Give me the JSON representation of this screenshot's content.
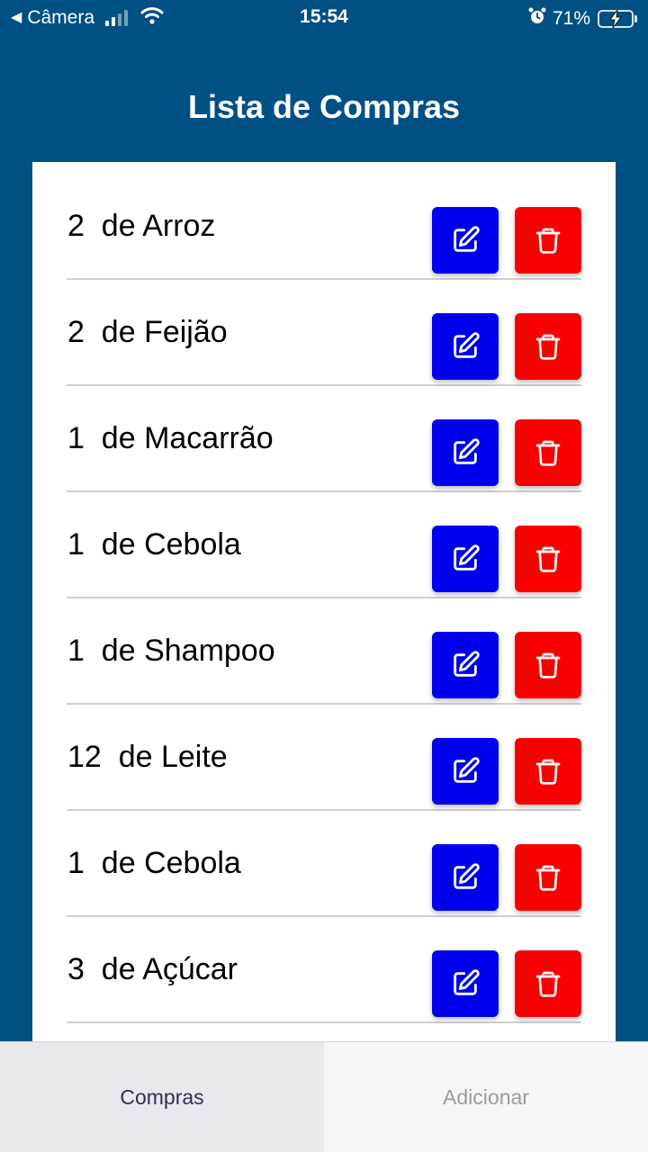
{
  "status_bar": {
    "back_arrow": "◀",
    "back_label": "Câmera",
    "time": "15:54",
    "battery_percent": "71%",
    "battery_level": 0.71,
    "icons": [
      "signal-icon",
      "wifi-icon",
      "alarm-icon",
      "battery-icon",
      "charging-bolt-icon"
    ]
  },
  "header": {
    "title": "Lista de Compras"
  },
  "list": {
    "items": [
      {
        "label": "2  de Arroz"
      },
      {
        "label": "2  de Feijão"
      },
      {
        "label": "1  de Macarrão"
      },
      {
        "label": "1  de Cebola"
      },
      {
        "label": "1  de Shampoo"
      },
      {
        "label": "12  de Leite"
      },
      {
        "label": "1  de Cebola"
      },
      {
        "label": "3  de Açúcar"
      }
    ],
    "edit_icon": "edit-icon",
    "delete_icon": "trash-icon"
  },
  "tabs": [
    {
      "label": "Compras",
      "active": true
    },
    {
      "label": "Adicionar",
      "active": false
    }
  ],
  "colors": {
    "header_bg": "#005084",
    "edit_button": "#0000ee",
    "delete_button": "#fb0000",
    "card_bg": "#ffffff"
  }
}
